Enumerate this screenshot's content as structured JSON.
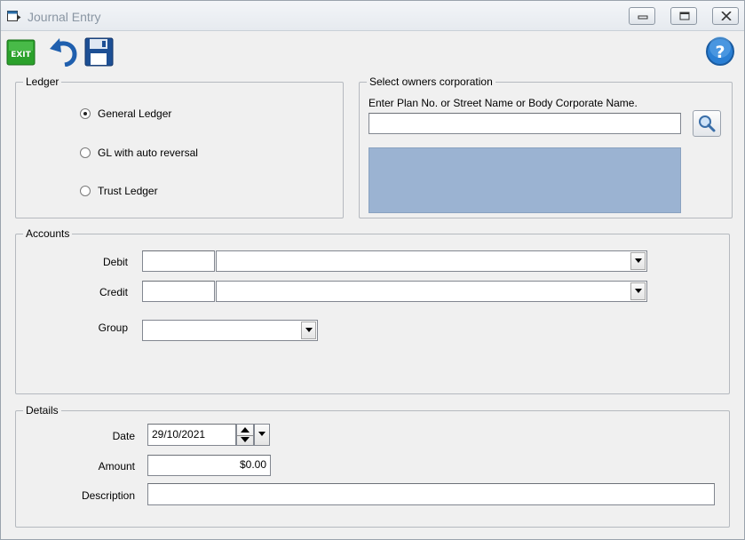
{
  "window": {
    "title": "Journal Entry"
  },
  "toolbar": {
    "exit_label": "EXIT"
  },
  "ledger": {
    "legend": "Ledger",
    "options": [
      {
        "label": "General Ledger",
        "checked": true
      },
      {
        "label": "GL with auto reversal",
        "checked": false
      },
      {
        "label": "Trust Ledger",
        "checked": false
      }
    ]
  },
  "owners": {
    "legend": "Select owners corporation",
    "prompt": "Enter Plan No. or Street Name or Body Corporate Name.",
    "search_value": ""
  },
  "accounts": {
    "legend": "Accounts",
    "debit_label": "Debit",
    "credit_label": "Credit",
    "group_label": "Group",
    "debit_code": "",
    "debit_name": "",
    "credit_code": "",
    "credit_name": "",
    "group_value": ""
  },
  "details": {
    "legend": "Details",
    "date_label": "Date",
    "date_value": "29/10/2021",
    "amount_label": "Amount",
    "amount_value": "$0.00",
    "description_label": "Description",
    "description_value": ""
  },
  "colors": {
    "selection_panel": "#9bb3d2",
    "title_text": "#8a96a3"
  }
}
